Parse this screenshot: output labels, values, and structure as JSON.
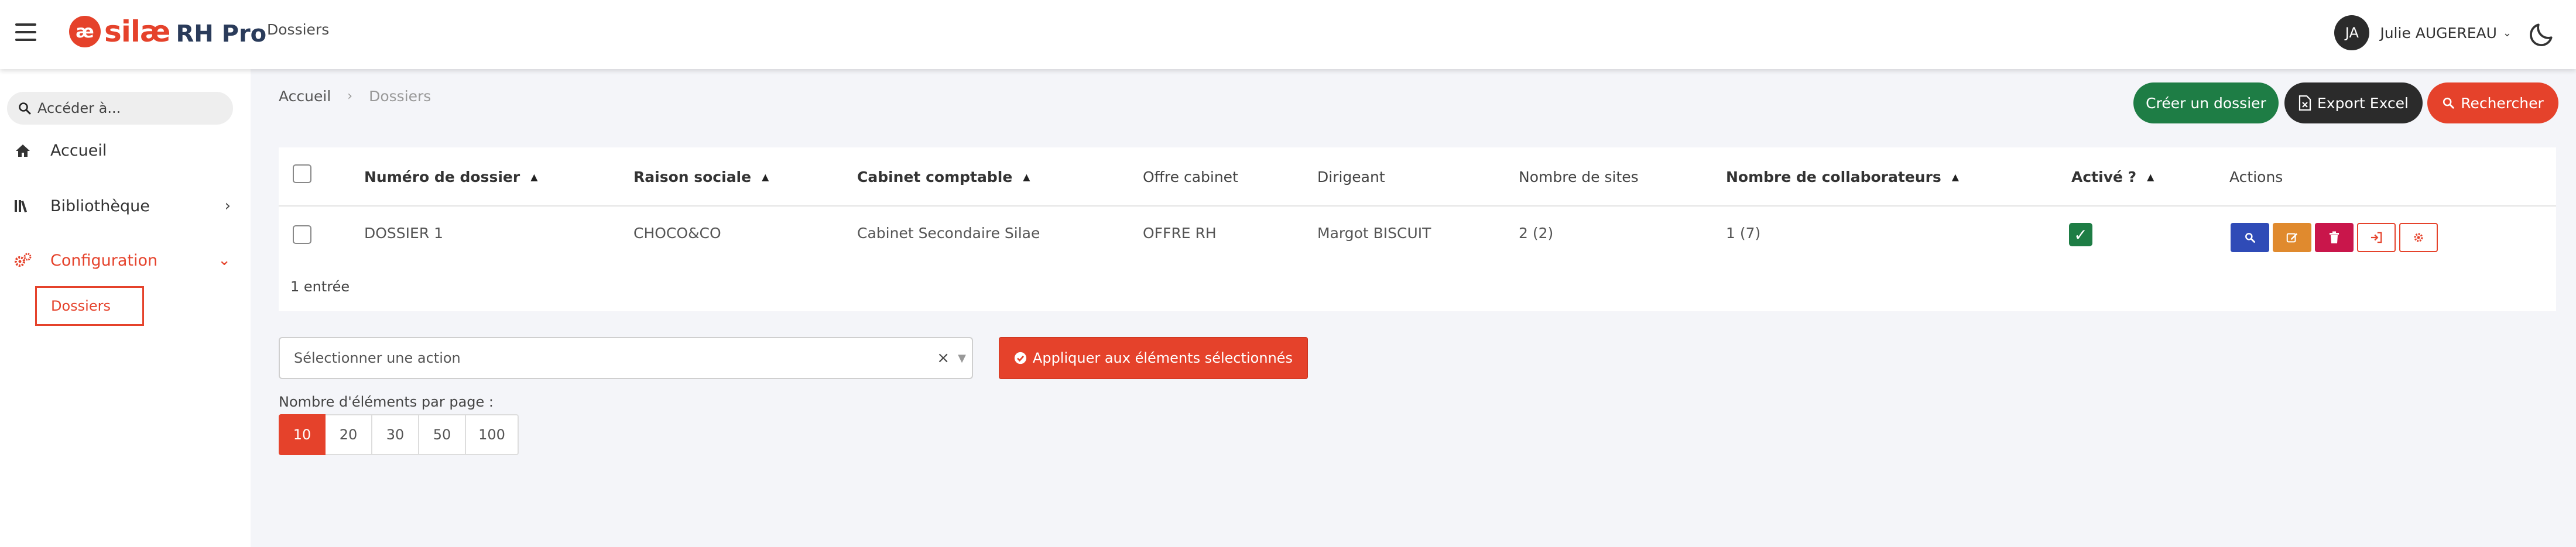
{
  "header": {
    "logo_mark": "æ",
    "logo_text": "silæ",
    "logo_suffix": "RH Pro",
    "page_title": "Dossiers",
    "user_initials": "JA",
    "user_name": "Julie AUGEREAU",
    "user_caret": "⌄"
  },
  "sidebar": {
    "search_placeholder": "Accéder à...",
    "items": [
      {
        "label": "Accueil",
        "icon": "home-icon"
      },
      {
        "label": "Bibliothèque",
        "icon": "library-icon",
        "chevron": "›"
      },
      {
        "label": "Configuration",
        "icon": "gears-icon",
        "chevron": "⌄"
      }
    ],
    "sub_items": [
      {
        "label": "Dossiers"
      }
    ]
  },
  "breadcrumb": {
    "home": "Accueil",
    "separator": "›",
    "current": "Dossiers"
  },
  "toolbar": {
    "create_label": "Créer un dossier",
    "export_label": "Export Excel",
    "search_label": "Rechercher"
  },
  "table": {
    "columns": [
      "Numéro de dossier",
      "Raison sociale",
      "Cabinet comptable",
      "Offre cabinet",
      "Dirigeant",
      "Nombre de sites",
      "Nombre de collaborateurs",
      "Activé ?",
      "Actions"
    ],
    "rows": [
      {
        "numero": "DOSSIER 1",
        "raison": "CHOCO&CO",
        "cabinet": "Cabinet Secondaire Silae",
        "offre": "OFFRE RH",
        "dirigeant": "Margot BISCUIT",
        "sites": "2 (2)",
        "collaborateurs": "1 (7)",
        "active": true
      }
    ],
    "entries_text": "1 entrée"
  },
  "bulk": {
    "select_placeholder": "Sélectionner une action",
    "clear": "×",
    "apply_label": "Appliquer aux éléments sélectionnés"
  },
  "pagination": {
    "label": "Nombre d'éléments par page :",
    "options": [
      "10",
      "20",
      "30",
      "50",
      "100"
    ],
    "selected": "10"
  },
  "colors": {
    "brand": "#e5422b",
    "create": "#1e7d45",
    "export": "#2b2b2b",
    "view": "#2f4bb7",
    "edit": "#e08a2e",
    "delete": "#c9164b"
  }
}
